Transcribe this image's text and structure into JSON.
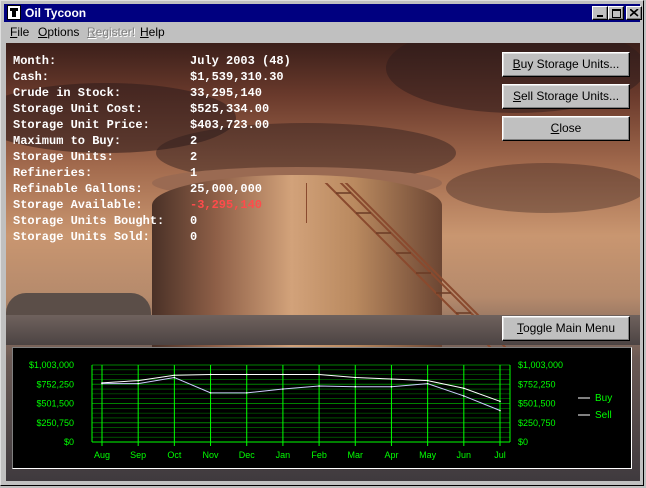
{
  "window": {
    "title": "Oil Tycoon"
  },
  "menubar": [
    {
      "label": "File",
      "mnemonic": "F",
      "rest": "ile",
      "enabled": true
    },
    {
      "label": "Options",
      "mnemonic": "O",
      "rest": "ptions",
      "enabled": true
    },
    {
      "label": "Register!",
      "mnemonic": "R",
      "rest": "egister!",
      "enabled": false
    },
    {
      "label": "Help",
      "mnemonic": "H",
      "rest": "elp",
      "enabled": true
    }
  ],
  "stats": [
    {
      "label": "Month:",
      "value": "July 2003 (48)"
    },
    {
      "label": "Cash:",
      "value": "$1,539,310.30"
    },
    {
      "label": "Crude in Stock:",
      "value": "33,295,140"
    },
    {
      "label": "Storage Unit Cost:",
      "value": "$525,334.00"
    },
    {
      "label": "Storage Unit Price:",
      "value": "$403,723.00"
    },
    {
      "label": "Maximum to Buy:",
      "value": "2"
    },
    {
      "label": "Storage Units:",
      "value": "2"
    },
    {
      "label": "Refineries:",
      "value": "1"
    },
    {
      "label": "Refinable Gallons:",
      "value": "25,000,000"
    },
    {
      "label": "Storage Available:",
      "value": "-3,295,140",
      "negative": true
    },
    {
      "label": "Storage Units Bought:",
      "value": "0"
    },
    {
      "label": "Storage Units Sold:",
      "value": "0"
    }
  ],
  "buttons": {
    "buy": {
      "mn": "B",
      "rest": "uy Storage Units..."
    },
    "sell": {
      "mn": "S",
      "rest": "ell Storage Units..."
    },
    "close": {
      "mn": "C",
      "rest": "lose"
    },
    "toggle": {
      "mn": "T",
      "rest": "oggle Main Menu"
    }
  },
  "chart_data": {
    "type": "line",
    "categories": [
      "Aug",
      "Sep",
      "Oct",
      "Nov",
      "Dec",
      "Jan",
      "Feb",
      "Mar",
      "Apr",
      "May",
      "Jun",
      "Jul"
    ],
    "yticks": [
      "$1,003,000",
      "$752,250",
      "$501,500",
      "$250,750",
      "$0"
    ],
    "ylim": [
      0,
      1003000
    ],
    "grid": true,
    "legend_position": "right",
    "series": [
      {
        "name": "Buy",
        "values": [
          770000,
          800000,
          870000,
          880000,
          880000,
          880000,
          880000,
          840000,
          820000,
          800000,
          700000,
          530000
        ]
      },
      {
        "name": "Sell",
        "values": [
          760000,
          760000,
          840000,
          640000,
          640000,
          690000,
          730000,
          720000,
          720000,
          760000,
          600000,
          410000
        ]
      }
    ],
    "colors": {
      "axis": "#00ff00",
      "grid": "#008000",
      "series": "#ffffff"
    }
  }
}
